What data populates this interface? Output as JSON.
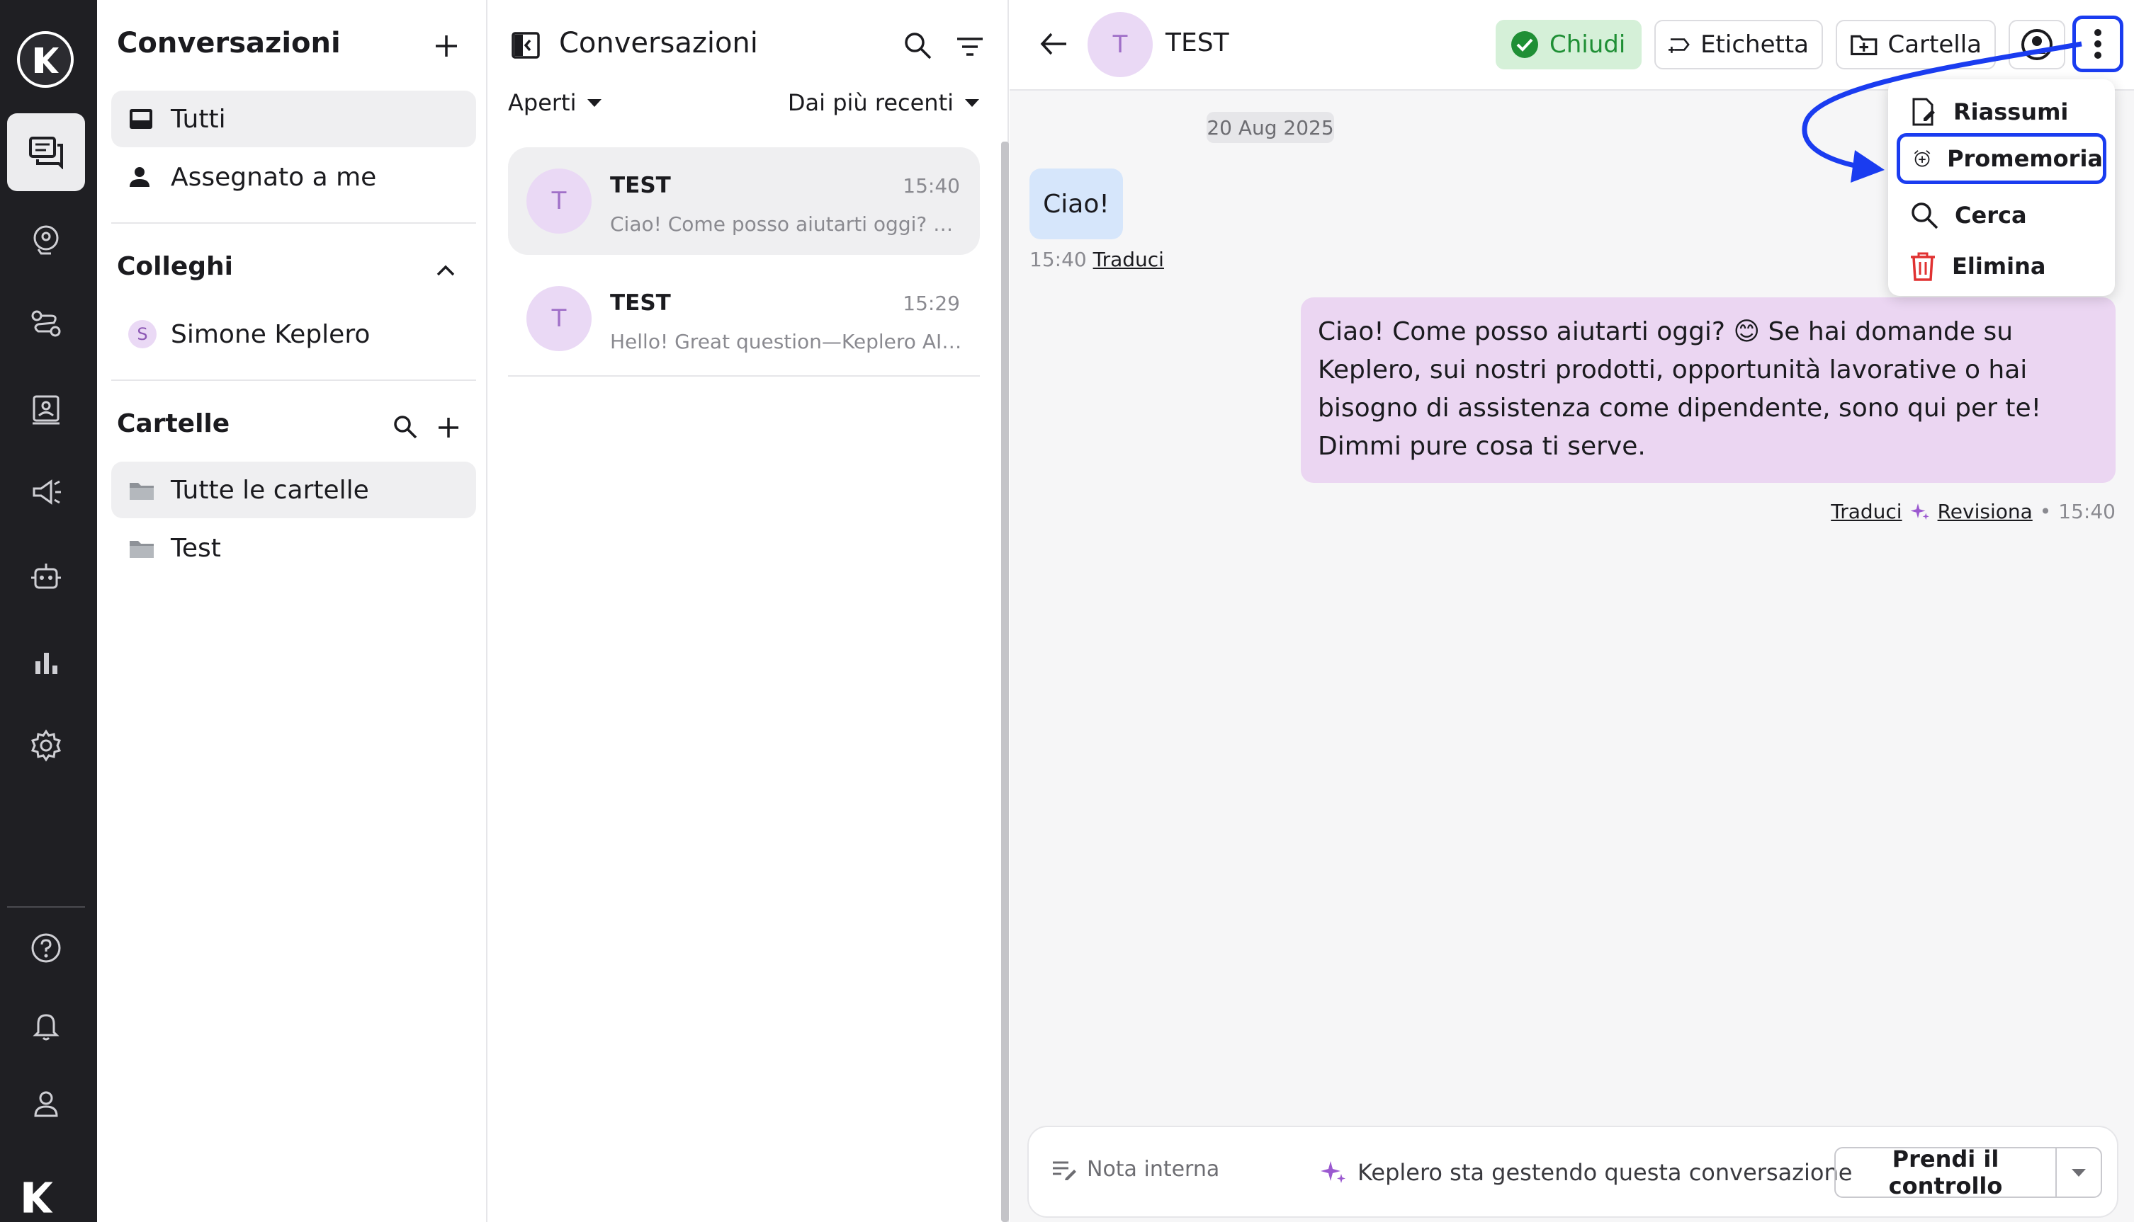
{
  "rail": {
    "items": [
      "chat-icon",
      "support-icon",
      "routing-icon",
      "contacts-icon",
      "campaign-icon",
      "bot-icon",
      "analytics-icon",
      "settings-icon"
    ],
    "bottom": [
      "help-icon",
      "bell-icon",
      "user-icon"
    ]
  },
  "folders": {
    "title": "Conversazioni",
    "inbox": [
      {
        "label": "Tutti",
        "active": true
      },
      {
        "label": "Assegnato a me",
        "active": false
      }
    ],
    "colleagues_title": "Colleghi",
    "colleagues": [
      {
        "initial": "S",
        "name": "Simone Keplero"
      }
    ],
    "folders_title": "Cartelle",
    "folder_items": [
      {
        "label": "Tutte le cartelle",
        "active": true
      },
      {
        "label": "Test",
        "active": false
      }
    ]
  },
  "list": {
    "title": "Conversazioni",
    "status_filter": "Aperti",
    "sort": "Dai più recenti",
    "conversations": [
      {
        "initial": "T",
        "name": "TEST",
        "time": "15:40",
        "preview": "Ciao! Come posso aiutarti oggi? 😊 Se hai domande su Keplero",
        "active": true
      },
      {
        "initial": "T",
        "name": "TEST",
        "time": "15:29",
        "preview": "Hello! Great question—Keplero AI can help you",
        "active": false
      }
    ]
  },
  "chat": {
    "contact_initial": "T",
    "contact_name": "TEST",
    "actions": {
      "close": "Chiudi",
      "label": "Etichetta",
      "folder": "Cartella"
    },
    "date": "20 Aug 2025",
    "messages": [
      {
        "direction": "in",
        "text": "Ciao!",
        "time": "15:40",
        "translate": "Traduci"
      },
      {
        "direction": "out",
        "text": "Ciao! Come posso aiutarti oggi? 😊 Se hai domande su Keplero, sui nostri prodotti, opportunità lavorative o hai bisogno di assistenza come dipendente, sono qui per te! Dimmi pure cosa ti serve.",
        "time": "15:40",
        "translate": "Traduci",
        "revise": "Revisiona"
      }
    ],
    "menu": [
      {
        "label": "Riassumi",
        "icon": "summary-icon"
      },
      {
        "label": "Promemoria",
        "icon": "alarm-add-icon",
        "highlighted": true
      },
      {
        "label": "Cerca",
        "icon": "search-icon"
      },
      {
        "label": "Elimina",
        "icon": "trash-icon"
      }
    ],
    "footer": {
      "internal_note": "Nota interna",
      "handling_text": "Keplero sta gestendo questa conversazione",
      "take_control": "Prendi il controllo"
    }
  },
  "colors": {
    "accent": "#1a3cf0",
    "close_green": "#1f8f35",
    "delete_red": "#e03131",
    "sparkle": "#9b59d0"
  }
}
